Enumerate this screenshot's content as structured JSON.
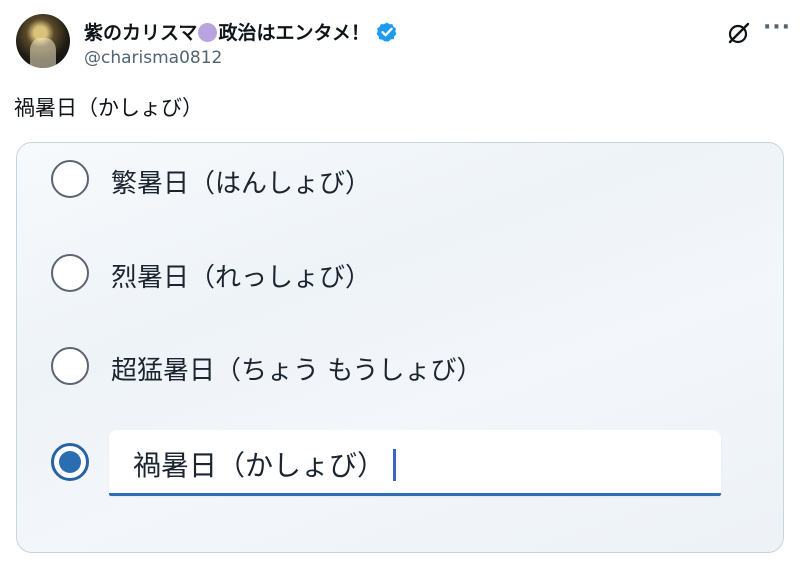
{
  "author": {
    "display_name_part1": "紫のカリスマ",
    "display_name_part2": "政治はエンタメ！",
    "handle": "@charisma0812"
  },
  "post": {
    "text": "禍暑日（かしょび）"
  },
  "poll": {
    "options": [
      {
        "label": "繁暑日（はんしょび）",
        "selected": false
      },
      {
        "label": "烈暑日（れっしょび）",
        "selected": false
      },
      {
        "label": "超猛暑日（ちょう もうしょび）",
        "selected": false
      }
    ],
    "custom_input": {
      "value": "禍暑日（かしょび）",
      "selected": true
    }
  },
  "colors": {
    "verified_badge": "#1d9bf0",
    "selected_radio": "#2a6db0",
    "input_underline": "#2f6fb1"
  },
  "icons": {
    "verified": "verified-badge-icon",
    "grok": "grok-icon",
    "more": "more-icon"
  }
}
